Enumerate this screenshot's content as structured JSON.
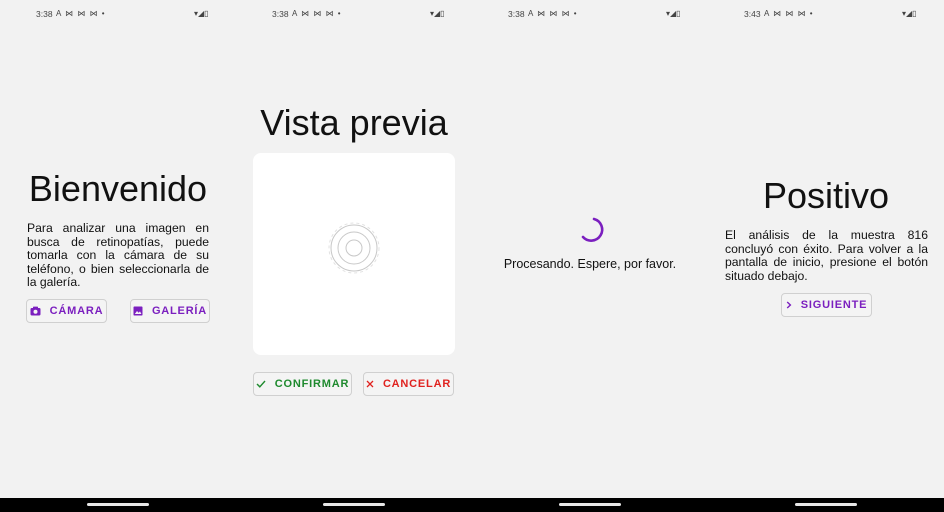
{
  "colors": {
    "accent": "#7b1fbf",
    "confirm": "#1e8a2e",
    "cancel": "#e0221f",
    "background": "#f2f2f2"
  },
  "screens": [
    {
      "status": {
        "time": "3:38",
        "icons": "A ⋈ ⋈ ⋈ •"
      },
      "title": "Bienvenido",
      "text": "Para analizar una imagen en busca de retinopatías, puede tomarla con la cámara de su teléfono, o bien seleccionarla de la galería.",
      "buttons": [
        {
          "label": "CÁMARA",
          "icon": "camera-icon"
        },
        {
          "label": "GALERÍA",
          "icon": "gallery-icon"
        }
      ]
    },
    {
      "status": {
        "time": "3:38",
        "icons": "A ⋈ ⋈ ⋈ •"
      },
      "title": "Vista previa",
      "image_icon": "retina-scan-icon",
      "buttons": [
        {
          "label": "CONFIRMAR",
          "icon": "check-icon"
        },
        {
          "label": "CANCELAR",
          "icon": "close-icon"
        }
      ]
    },
    {
      "status": {
        "time": "3:38",
        "icons": "A ⋈ ⋈ ⋈ •"
      },
      "spinner": "loading-spinner",
      "message": "Procesando. Espere, por favor."
    },
    {
      "status": {
        "time": "3:43",
        "icons": "A ⋈ ⋈ ⋈ •"
      },
      "title": "Positivo",
      "text": "El análisis de la muestra 816 concluyó con éxito. Para volver a la pantalla de inicio, presione el botón situado debajo.",
      "buttons": [
        {
          "label": "SIGUIENTE",
          "icon": "chevron-right-icon"
        }
      ]
    }
  ]
}
